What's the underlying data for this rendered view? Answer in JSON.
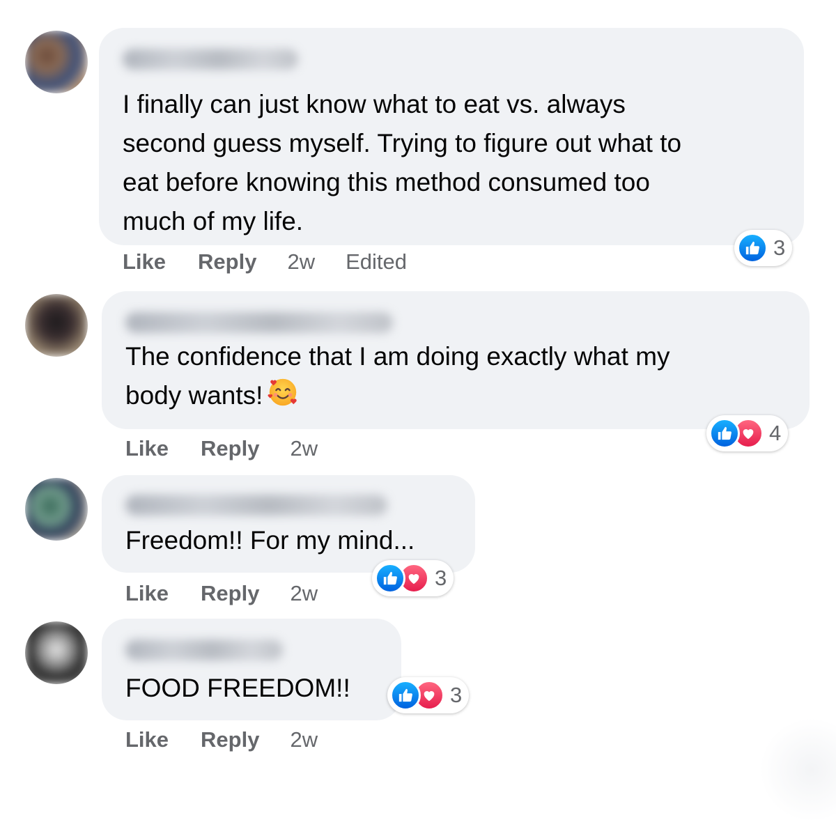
{
  "comments": [
    {
      "text": "I finally can just know what to eat vs. always\nsecond guess myself. Trying to figure out what to\neat before knowing this method consumed too\nmuch of my life.",
      "like": "Like",
      "reply": "Reply",
      "time": "2w",
      "edited": "Edited",
      "reaction_count": "3",
      "reactions": [
        "like-icon"
      ]
    },
    {
      "text": "The confidence that I am doing exactly what my\nbody wants!",
      "emoji": "smiling-face-with-hearts-icon",
      "like": "Like",
      "reply": "Reply",
      "time": "2w",
      "reaction_count": "4",
      "reactions": [
        "like-icon",
        "love-icon"
      ]
    },
    {
      "text": "Freedom!! For my mind...",
      "like": "Like",
      "reply": "Reply",
      "time": "2w",
      "reaction_count": "3",
      "reactions": [
        "like-icon",
        "love-icon"
      ]
    },
    {
      "text": "FOOD FREEDOM!!",
      "like": "Like",
      "reply": "Reply",
      "time": "2w",
      "reaction_count": "3",
      "reactions": [
        "like-icon",
        "love-icon"
      ]
    }
  ],
  "colors": {
    "bubble": "#f0f2f5",
    "action_text": "#65676b",
    "like_blue": "#0866ff",
    "love_red": "#f33e58"
  }
}
